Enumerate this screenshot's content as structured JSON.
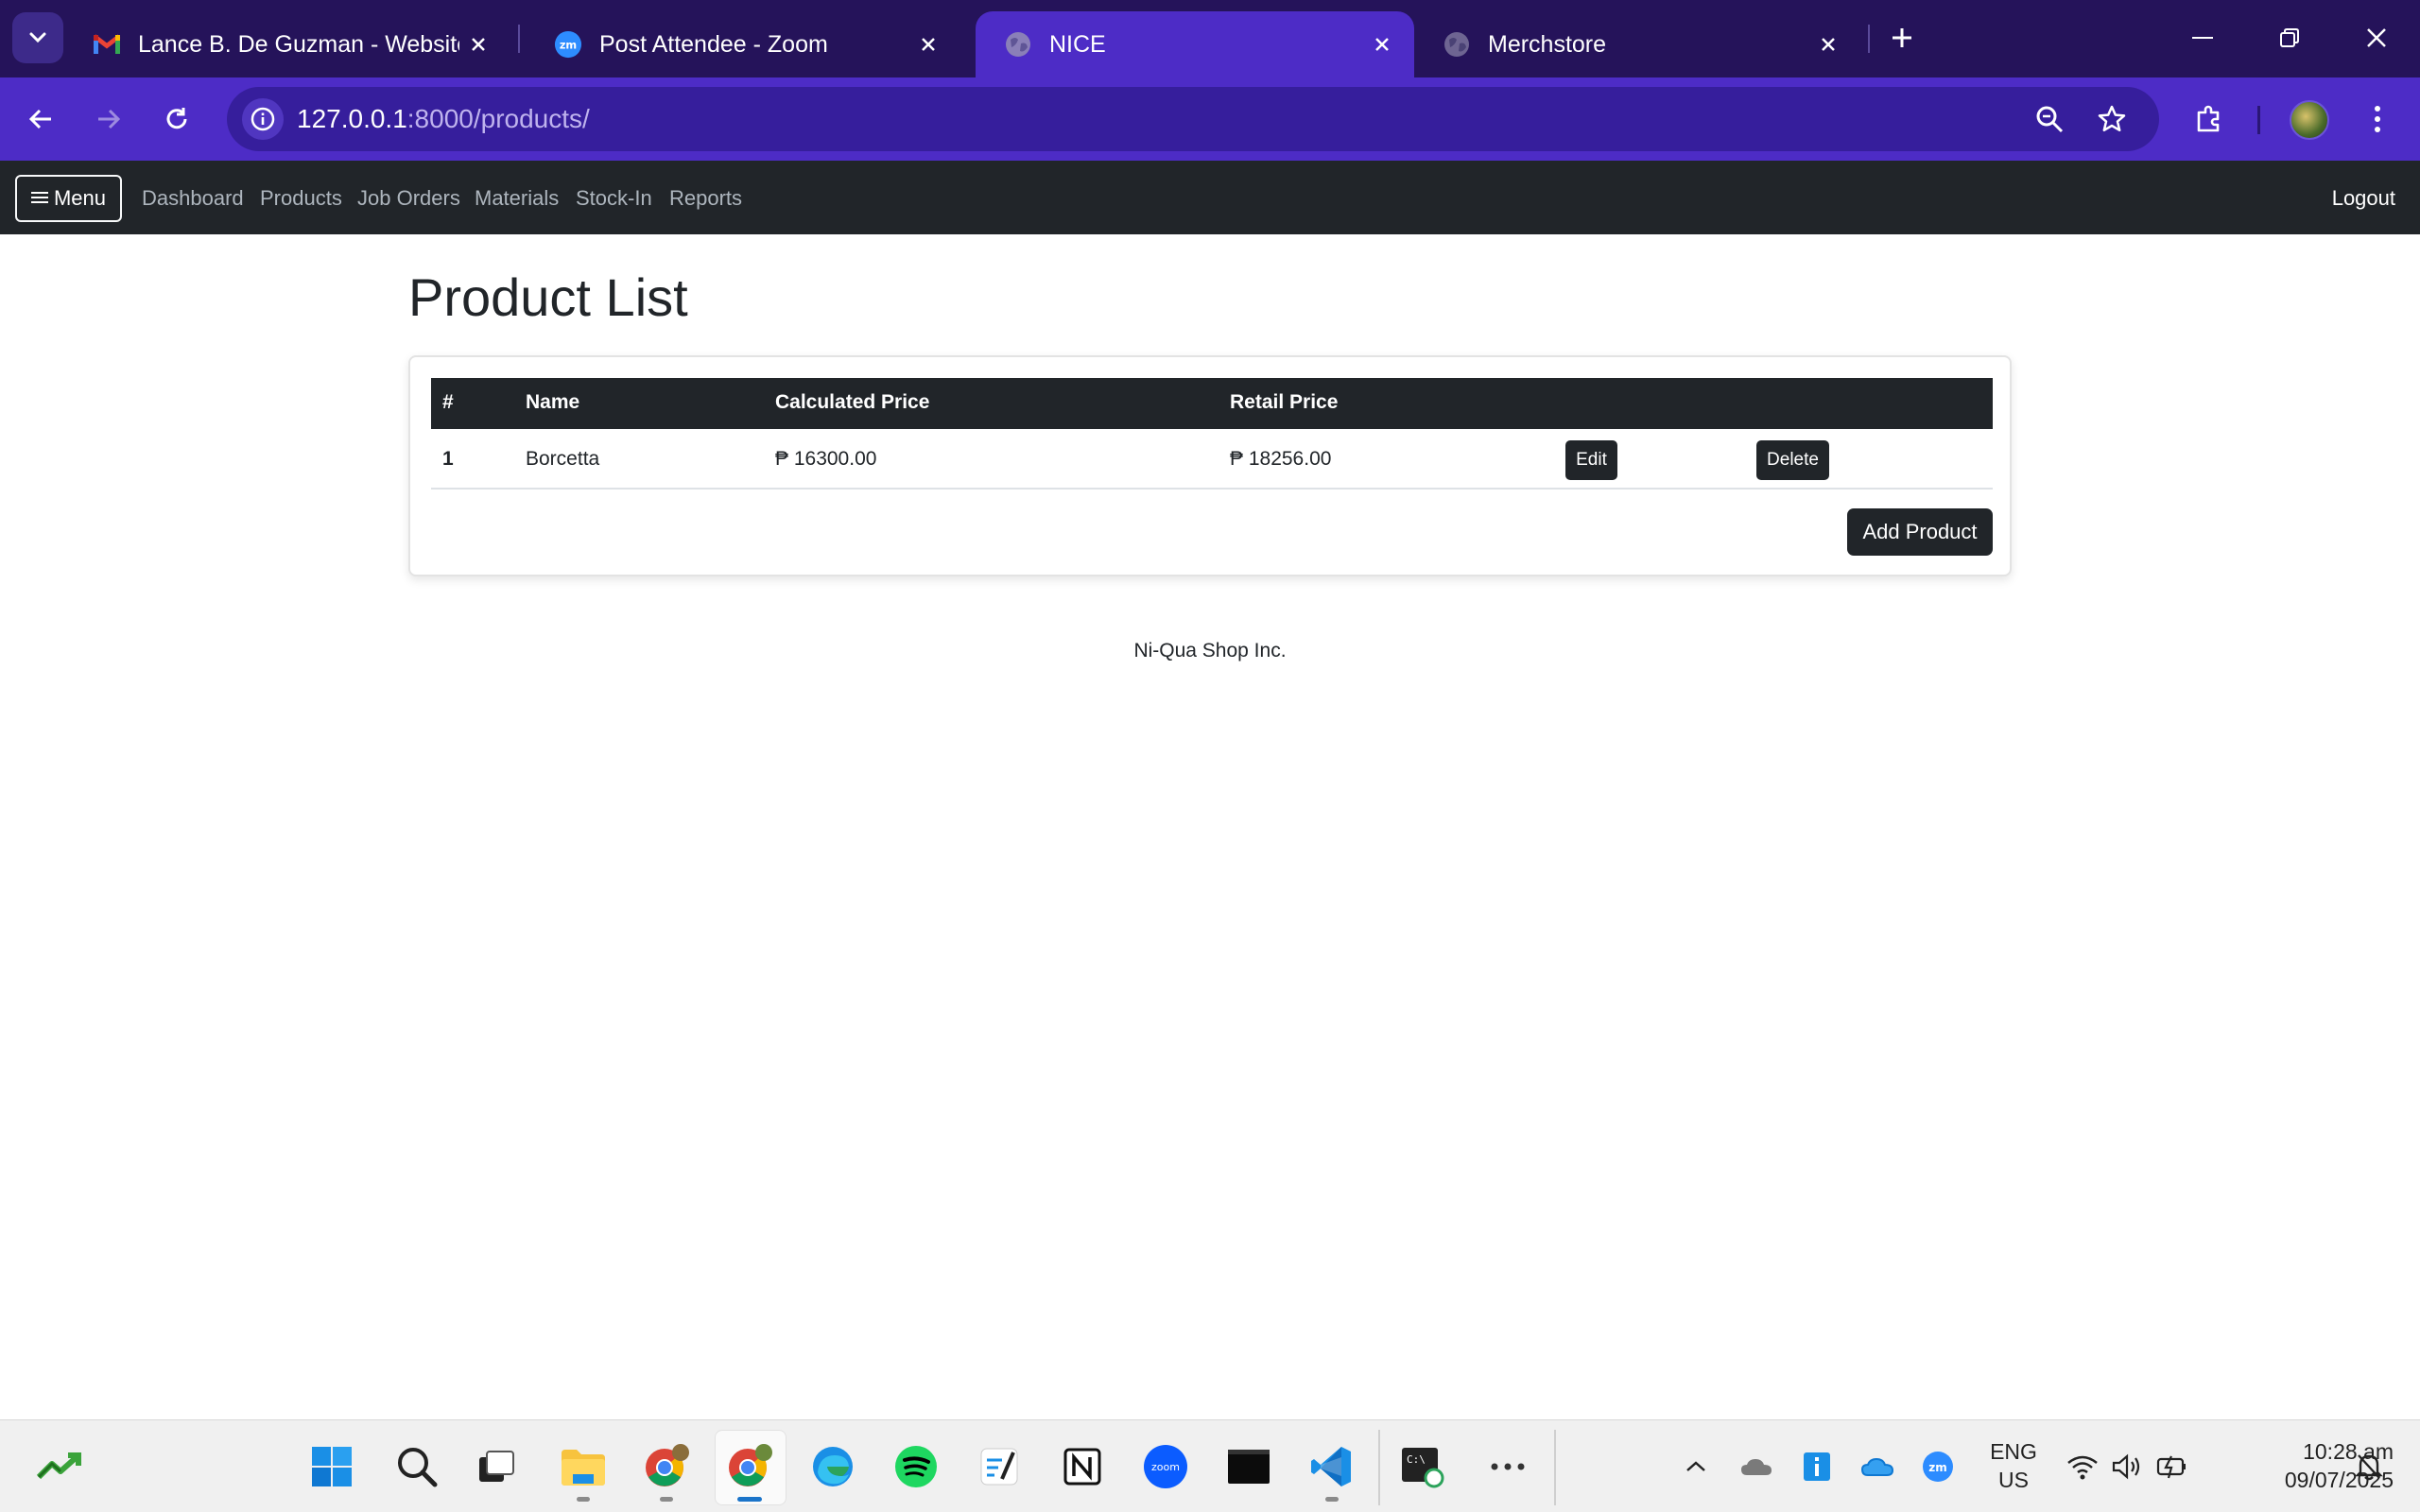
{
  "browser": {
    "tabs": [
      {
        "title": "Lance B. De Guzman - Website",
        "icon": "gmail-icon"
      },
      {
        "title": "Post Attendee - Zoom",
        "icon": "zoom-icon"
      },
      {
        "title": "NICE",
        "icon": "globe-icon",
        "active": true
      },
      {
        "title": "Merchstore",
        "icon": "globe-icon"
      }
    ],
    "url_host": "127.0.0.1",
    "url_path": ":8000/products/"
  },
  "navbar": {
    "menu_label": "Menu",
    "links": [
      "Dashboard",
      "Products",
      "Job Orders",
      "Materials",
      "Stock-In",
      "Reports"
    ],
    "logout_label": "Logout"
  },
  "page": {
    "title": "Product List",
    "table": {
      "headers": [
        "#",
        "Name",
        "Calculated Price",
        "Retail Price"
      ],
      "rows": [
        {
          "num": "1",
          "name": "Borcetta",
          "calculated_price": "₱ 16300.00",
          "retail_price": "₱ 18256.00",
          "edit_label": "Edit",
          "delete_label": "Delete"
        }
      ]
    },
    "add_button_label": "Add Product",
    "footer": "Ni-Qua Shop Inc."
  },
  "taskbar": {
    "apps": [
      "stocks-widget-icon",
      "windows-start-icon",
      "search-icon",
      "task-view-icon",
      "file-explorer-icon",
      "chrome-profile-1-icon",
      "chrome-profile-2-icon",
      "edge-icon",
      "spotify-icon",
      "writing-app-icon",
      "notion-icon",
      "zoom-icon",
      "terminal-icon",
      "vscode-icon",
      "cmd-icon",
      "more-icon"
    ],
    "language_line1": "ENG",
    "language_line2": "US",
    "time": "10:28 am",
    "date": "09/07/2025"
  },
  "colors": {
    "tabbar_bg": "#25135a",
    "toolbar_bg": "#4d2cc6",
    "navbar_bg": "#212529",
    "button_dark": "#212529"
  }
}
